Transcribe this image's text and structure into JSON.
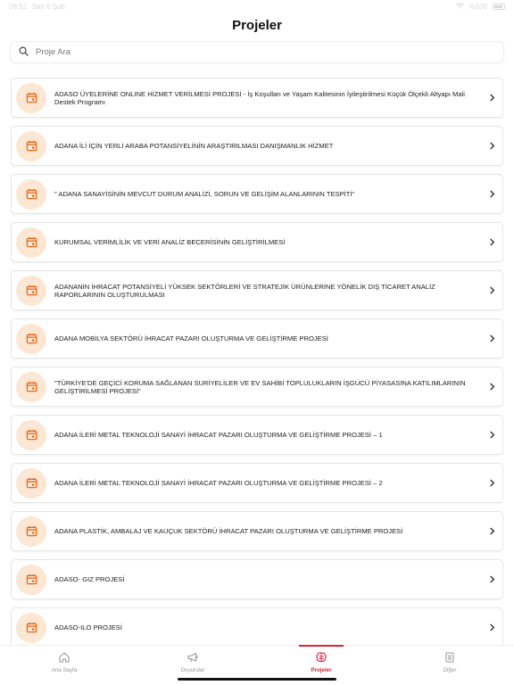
{
  "status": {
    "time": "09:52",
    "date": "Salı 6 Şub",
    "battery": "%100"
  },
  "title": "Projeler",
  "search": {
    "placeholder": "Proje Ara",
    "icon": "search-icon"
  },
  "colors": {
    "accent": "#d8263a",
    "icon_bg": "#fbe7d3",
    "icon_fg": "#e56a1d"
  },
  "projects": [
    {
      "label": "ADASO ÜYELERİNE ONLINE HİZMET VERİLMESİ PROJESİ - İş Koşulları ve Yaşam Kalitesinin İyileştirilmesi Küçük Ölçekli Altyapı Mali Destek Programı",
      "icon": "calendar-icon"
    },
    {
      "label": "ADANA İLİ İÇİN YERLİ ARABA POTANSİYELİNİN ARAŞTIRILMASI DANIŞMANLIK HİZMET",
      "icon": "calendar-icon"
    },
    {
      "label": "\" ADANA SANAYİSİNİN MEVCUT DURUM ANALİZİ, SORUN VE GELİŞİM ALANLARININ TESPİTİ\"",
      "icon": "calendar-icon"
    },
    {
      "label": "KURUMSAL VERİMLİLİK VE VERİ ANALİZ BECERİSİNİN GELİŞTİRİLMESİ",
      "icon": "calendar-icon"
    },
    {
      "label": "ADANANIN İHRACAT POTANSİYELİ YÜKSEK SEKTÖRLERİ VE STRATEJİK ÜRÜNLERİNE YÖNELİK DIŞ TİCARET ANALİZ RAPORLARININ OLUŞTURULMASI",
      "icon": "calendar-icon"
    },
    {
      "label": "ADANA MOBİLYA SEKTÖRÜ  İHRACAT PAZARI OLUŞTURMA VE GELİŞTİRME PROJESİ",
      "icon": "calendar-icon"
    },
    {
      "label": "\"TÜRKİYE'DE GEÇİCİ KORUMA SAĞLANAN SURİYELİLER VE EV SAHİBİ TOPLULUKLARIN İŞGÜCÜ PİYASASINA KATILIMLARININ GELİŞTİRİLMESİ PROJESİ\"",
      "icon": "calendar-icon"
    },
    {
      "label": "ADANA İLERİ METAL TEKNOLOJİ SANAYİ İHRACAT PAZARI OLUŞTURMA VE GELİŞTİRME PROJESİ – 1",
      "icon": "calendar-icon"
    },
    {
      "label": "ADANA İLERİ METAL TEKNOLOJİ SANAYİ İHRACAT PAZARI OLUŞTURMA VE GELİŞTİRME PROJESİ – 2",
      "icon": "calendar-icon"
    },
    {
      "label": "ADANA PLASTİK, AMBALAJ VE KAUÇUK SEKTÖRÜ  İHRACAT PAZARI OLUŞTURMA VE GELİŞTİRME PROJESİ",
      "icon": "calendar-icon"
    },
    {
      "label": "ADASO- GIZ PROJESİ",
      "icon": "calendar-icon"
    },
    {
      "label": "ADASO-ILO PROJESİ",
      "icon": "calendar-icon"
    }
  ],
  "tabs": [
    {
      "label": "Ana Sayfa",
      "icon": "home-icon",
      "active": false
    },
    {
      "label": "Duyurular",
      "icon": "megaphone-icon",
      "active": false
    },
    {
      "label": "Projeler",
      "icon": "brain-icon",
      "active": true
    },
    {
      "label": "Diğer",
      "icon": "list-icon",
      "active": false
    }
  ]
}
